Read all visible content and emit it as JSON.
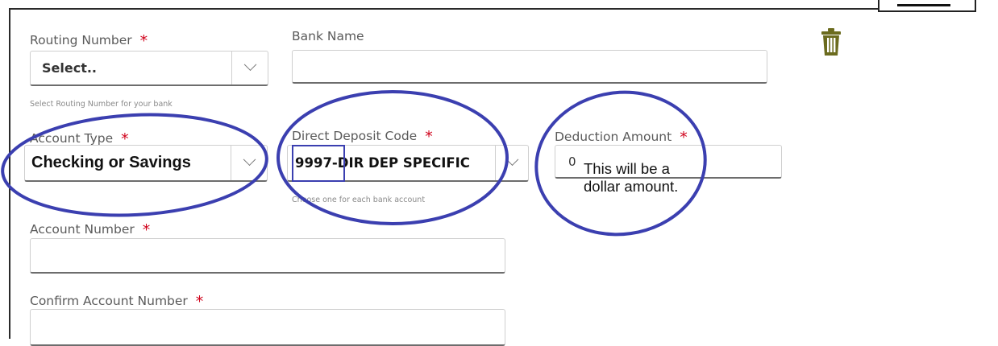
{
  "form": {
    "routing_number": {
      "label": "Routing Number",
      "required_mark": "*",
      "value": "Select..",
      "hint": "Select Routing Number for your bank"
    },
    "bank_name": {
      "label": "Bank Name",
      "value": ""
    },
    "account_type": {
      "label": "Account Type",
      "required_mark": "*",
      "value": "Checking or Savings"
    },
    "direct_deposit_code": {
      "label": "Direct Deposit Code",
      "required_mark": "*",
      "value": "9997-DIR DEP SPECIFIC",
      "hint": "Choose one for each bank account"
    },
    "deduction_amount": {
      "label": "Deduction Amount",
      "required_mark": "*",
      "value": "0"
    },
    "account_number": {
      "label": "Account Number",
      "required_mark": "*",
      "value": ""
    },
    "confirm_account_number": {
      "label": "Confirm Account Number",
      "required_mark": "*",
      "value": ""
    }
  },
  "annotation": {
    "text": "This will be a dollar amount."
  },
  "icons": {
    "delete": "trash-icon",
    "dropdown": "chevron-down-icon"
  },
  "colors": {
    "annotation": "#3b3fb0",
    "required": "#d0021b",
    "trash": "#6b6b1e"
  }
}
